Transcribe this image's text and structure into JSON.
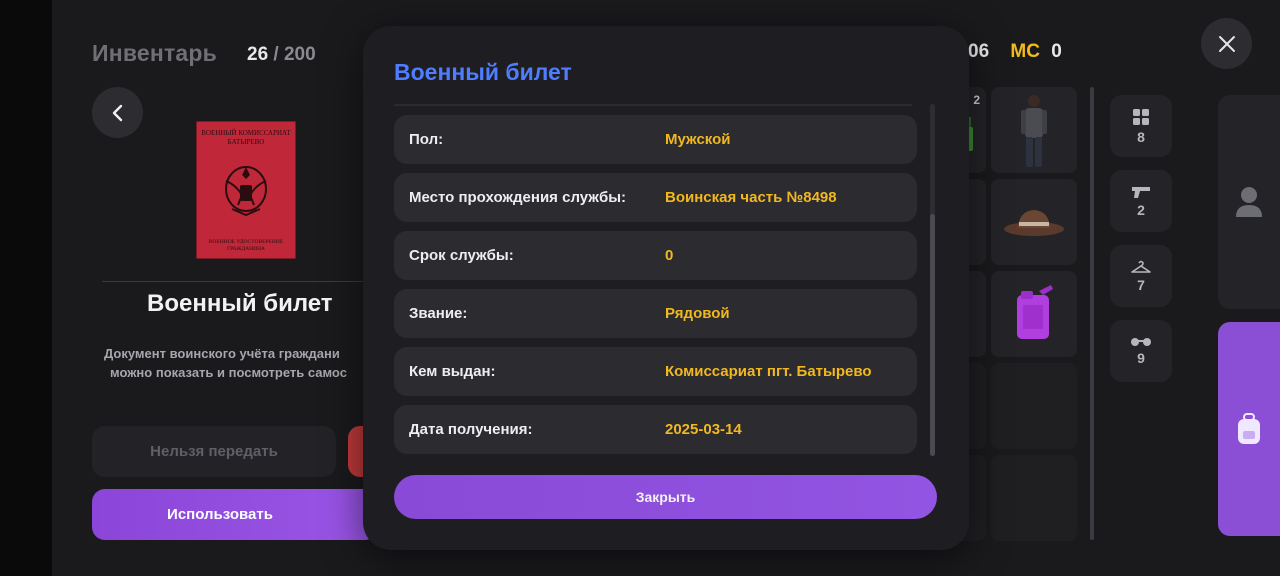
{
  "header": {
    "title": "Инвентарь",
    "count": "26",
    "separator": "/",
    "capacity": "200",
    "money_value": "06",
    "currency_label": "MC",
    "currency_value": "0"
  },
  "item": {
    "booklet_title": "ВОЕННЫЙ КОМИССАРИАТ БАТЫРЕВО",
    "booklet_footer": "ВОЕННОЕ УДОСТОВЕРЕНИЕ ГРАЖДАНИНА",
    "name": "Военный билет",
    "description_line1": "Документ воинского учёта граждани",
    "description_line2": "можно показать и посмотреть самос"
  },
  "buttons": {
    "transfer": "Нельзя передать",
    "use": "Использовать"
  },
  "slots": {
    "badge": "2"
  },
  "categories": [
    {
      "icon": "grid-icon",
      "count": "8"
    },
    {
      "icon": "pistol-icon",
      "count": "2"
    },
    {
      "icon": "hanger-icon",
      "count": "7"
    },
    {
      "icon": "glasses-icon",
      "count": "9"
    }
  ],
  "modal": {
    "title": "Военный билет",
    "rows": [
      {
        "label": "Пол:",
        "value": "Мужской"
      },
      {
        "label": "Место прохождения службы:",
        "value": "Воинская часть №8498"
      },
      {
        "label": "Срок службы:",
        "value": "0"
      },
      {
        "label": "Звание:",
        "value": "Рядовой"
      },
      {
        "label": "Кем выдан:",
        "value": "Комиссариат пгт. Батырево"
      },
      {
        "label": "Дата получения:",
        "value": "2025-03-14"
      }
    ],
    "close_label": "Закрыть"
  },
  "colors": {
    "accent_purple": "#8b46d9",
    "title_blue": "#4f7dff",
    "value_gold": "#f1b81f",
    "booklet_red": "#c0283a"
  }
}
